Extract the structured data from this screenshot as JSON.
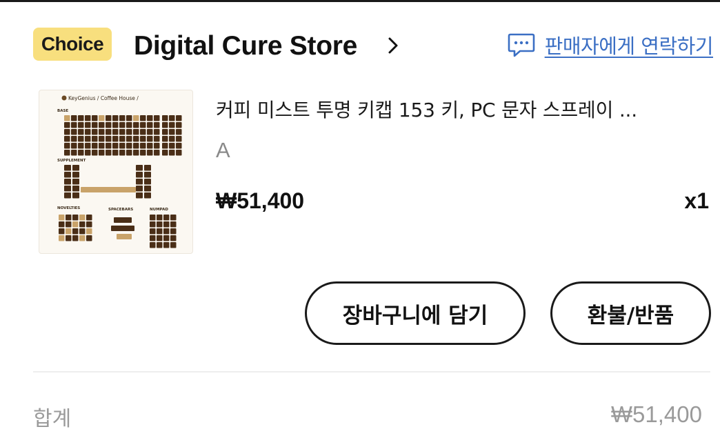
{
  "store": {
    "badge": "Choice",
    "name": "Digital Cure Store",
    "contact_label": "판매자에게 연락하기"
  },
  "product": {
    "title": "커피 미스트 투명 키캡 153 키, PC 문자 스프레이 ...",
    "variant": "A",
    "price": "₩51,400",
    "quantity": "x1",
    "thumbnail": {
      "header": "KeyGenius / Coffee House /",
      "sections": [
        "BASE",
        "SUPPLEMENT",
        "NOVELTIES",
        "SPACEBARS",
        "NUMPAD"
      ]
    }
  },
  "actions": {
    "add_to_cart": "장바구니에 담기",
    "refund_return": "환불/반품"
  },
  "summary": {
    "total_label": "합계",
    "total_value": "₩51,400"
  },
  "colors": {
    "badge_bg": "#f8df7e",
    "link": "#3b6fc4",
    "muted": "#9a9a9a",
    "keycap_dark": "#4a2e17",
    "keycap_light": "#c9a36a"
  }
}
